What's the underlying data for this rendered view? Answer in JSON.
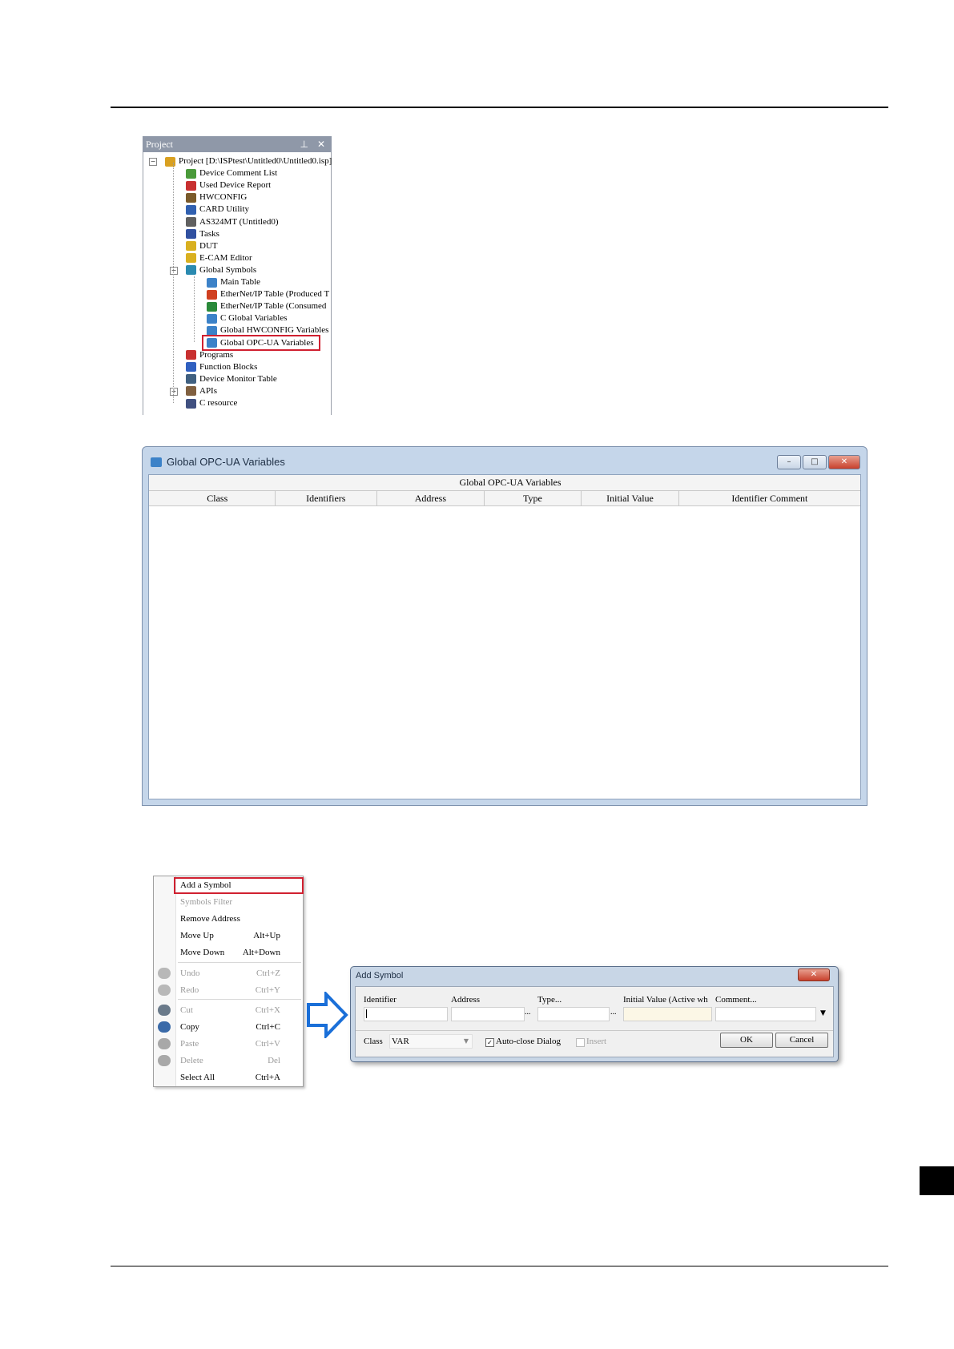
{
  "project_panel": {
    "title": "Project",
    "controls": "\u0004 ✕",
    "items": [
      {
        "label": "Project [D:\\ISPtest\\Untitled0\\Untitled0.isp]",
        "icon": "project-icon",
        "color": "#d9a020"
      },
      {
        "label": "Device Comment List",
        "icon": "comment-list-icon",
        "color": "#4a9a3a"
      },
      {
        "label": "Used Device Report",
        "icon": "report-icon",
        "color": "#c83030"
      },
      {
        "label": "HWCONFIG",
        "icon": "hwconfig-icon",
        "color": "#7a5a2a"
      },
      {
        "label": "CARD Utility",
        "icon": "card-icon",
        "color": "#3060b0"
      },
      {
        "label": "AS324MT  (Untitled0)",
        "icon": "plc-icon",
        "color": "#606060"
      },
      {
        "label": "Tasks",
        "icon": "tasks-icon",
        "color": "#3050a0"
      },
      {
        "label": "DUT",
        "icon": "dut-icon",
        "color": "#d9b020"
      },
      {
        "label": "E-CAM Editor",
        "icon": "ecam-icon",
        "color": "#d9b020"
      },
      {
        "label": "Global Symbols",
        "icon": "global-symbols-icon",
        "color": "#2a8ab0"
      },
      {
        "label": "Main Table",
        "icon": "table-icon",
        "color": "#3c82c8"
      },
      {
        "label": "EtherNet/IP Table (Produced T",
        "icon": "ethernet-produced-icon",
        "color": "#d04020"
      },
      {
        "label": "EtherNet/IP Table (Consumed",
        "icon": "ethernet-consumed-icon",
        "color": "#2a8a3a"
      },
      {
        "label": "C Global Variables",
        "icon": "table-icon",
        "color": "#3c82c8"
      },
      {
        "label": "Global HWCONFIG Variables",
        "icon": "table-icon",
        "color": "#3c82c8"
      },
      {
        "label": "Global OPC-UA Variables",
        "icon": "table-icon",
        "color": "#3c82c8"
      },
      {
        "label": "Programs",
        "icon": "programs-icon",
        "color": "#c83030"
      },
      {
        "label": "Function Blocks",
        "icon": "function-blocks-icon",
        "color": "#3060c0"
      },
      {
        "label": "Device Monitor Table",
        "icon": "monitor-table-icon",
        "color": "#406080"
      },
      {
        "label": "APIs",
        "icon": "apis-icon",
        "color": "#806040"
      },
      {
        "label": "C resource",
        "icon": "c-resource-icon",
        "color": "#405080"
      }
    ]
  },
  "opc_window": {
    "title": "Global OPC-UA Variables",
    "buttons": {
      "minimize": "–",
      "maximize": "□",
      "close": "✕"
    },
    "grid_caption": "Global OPC-UA Variables",
    "columns": [
      "Class",
      "Identifiers",
      "Address",
      "Type",
      "Initial Value",
      "Identifier Comment"
    ]
  },
  "context_menu": {
    "items": [
      {
        "label": "Add a Symbol",
        "shortcut": "",
        "disabled": false
      },
      {
        "label": "Symbols Filter",
        "shortcut": "",
        "disabled": true
      },
      {
        "label": "Remove Address",
        "shortcut": "",
        "disabled": false
      },
      {
        "label": "Move Up",
        "shortcut": "Alt+Up",
        "disabled": false
      },
      {
        "label": "Move Down",
        "shortcut": "Alt+Down",
        "disabled": false
      },
      {
        "label": "Undo",
        "shortcut": "Ctrl+Z",
        "disabled": true
      },
      {
        "label": "Redo",
        "shortcut": "Ctrl+Y",
        "disabled": true
      },
      {
        "label": "Cut",
        "shortcut": "Ctrl+X",
        "disabled": true
      },
      {
        "label": "Copy",
        "shortcut": "Ctrl+C",
        "disabled": false
      },
      {
        "label": "Paste",
        "shortcut": "Ctrl+V",
        "disabled": true
      },
      {
        "label": "Delete",
        "shortcut": "Del",
        "disabled": true
      },
      {
        "label": "Select All",
        "shortcut": "Ctrl+A",
        "disabled": false
      }
    ]
  },
  "add_symbol_dialog": {
    "title": "Add Symbol",
    "close": "✕",
    "identifier_label": "Identifier",
    "address_label": "Address",
    "type_label": "Type...",
    "initial_value_label": "Initial Value (Active wh",
    "comment_label": "Comment...",
    "ellipsis": "...",
    "class_label": "Class",
    "class_value": "VAR",
    "auto_close_label": "Auto-close Dialog",
    "auto_close_checked": true,
    "insert_label": "Insert",
    "insert_checked": false,
    "ok_label": "OK",
    "cancel_label": "Cancel"
  },
  "colors": {
    "highlight": "#d02030",
    "arrow": "#1a6fd8"
  }
}
